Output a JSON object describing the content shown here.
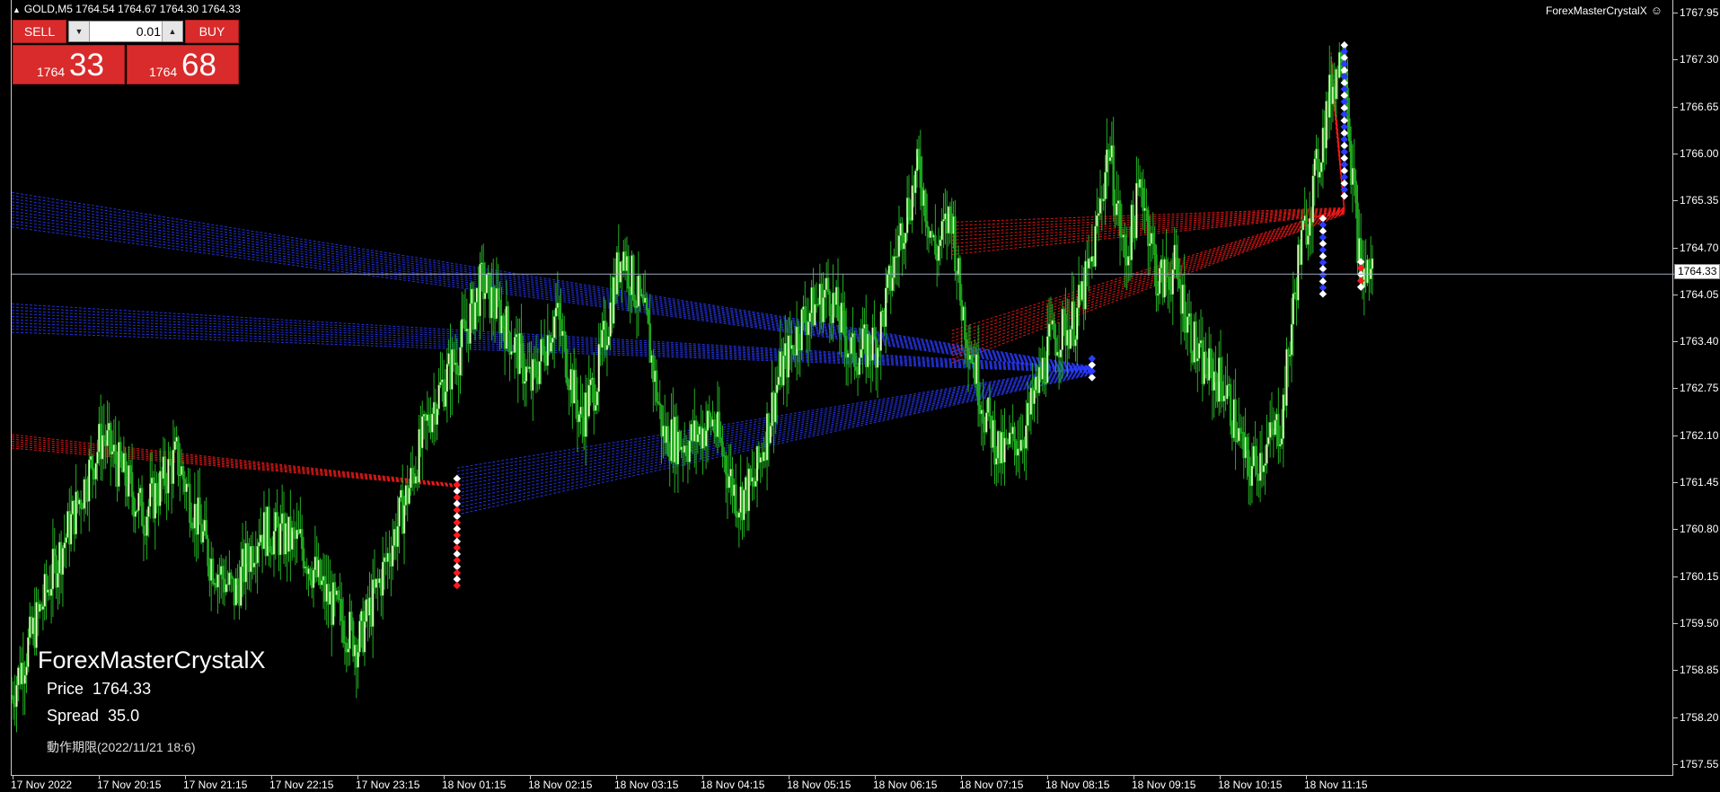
{
  "header": {
    "symbol_title": "GOLD,M5  1764.54 1764.67 1764.30 1764.33",
    "expert_name": "ForexMasterCrystalX"
  },
  "icons": {
    "collapse": "collapse-triangle-icon",
    "smile": "smiley-icon",
    "lot_down": "chevron-down-icon",
    "lot_up": "chevron-up-icon"
  },
  "trade_panel": {
    "sell_label": "SELL",
    "buy_label": "BUY",
    "lot_value": "0.01",
    "bid_small": "1764",
    "bid_big": "33",
    "ask_small": "1764",
    "ask_big": "68"
  },
  "info": {
    "title": "ForexMasterCrystalX",
    "price_label": "Price",
    "price_value": "1764.33",
    "spread_label": "Spread",
    "spread_value": "35.0",
    "expiry": "動作期限(2022/11/21 18:6)"
  },
  "price_axis": {
    "labels": [
      "1767.95",
      "1767.30",
      "1766.65",
      "1766.00",
      "1765.35",
      "1764.70",
      "1764.05",
      "1763.40",
      "1762.75",
      "1762.10",
      "1761.45",
      "1760.80",
      "1760.15",
      "1759.50",
      "1758.85",
      "1758.20",
      "1757.55"
    ],
    "current": "1764.33"
  },
  "time_axis": {
    "labels": [
      "17 Nov 2022",
      "17 Nov 20:15",
      "17 Nov 21:15",
      "17 Nov 22:15",
      "17 Nov 23:15",
      "18 Nov 01:15",
      "18 Nov 02:15",
      "18 Nov 03:15",
      "18 Nov 04:15",
      "18 Nov 05:15",
      "18 Nov 06:15",
      "18 Nov 07:15",
      "18 Nov 08:15",
      "18 Nov 09:15",
      "18 Nov 10:15",
      "18 Nov 11:15"
    ]
  },
  "colors": {
    "background": "#000000",
    "candle_up": "#f2ffcc",
    "candle_down": "#1ba81b",
    "wick": "#22b022",
    "sell_button": "#d92b2b",
    "blue_fan": "#2a3bff",
    "red_fan": "#ff1a1a",
    "grid_line": "#a0a8c0"
  },
  "chart_data": {
    "type": "candlestick",
    "ylim": [
      1757.4,
      1768.1
    ],
    "current_price": 1764.33,
    "close_path": [
      [
        0,
        1758.5
      ],
      [
        25,
        1760.2
      ],
      [
        55,
        1762.1
      ],
      [
        80,
        1761.0
      ],
      [
        100,
        1761.8
      ],
      [
        120,
        1760.4
      ],
      [
        135,
        1759.9
      ],
      [
        150,
        1760.8
      ],
      [
        175,
        1760.6
      ],
      [
        190,
        1759.9
      ],
      [
        210,
        1759.2
      ],
      [
        225,
        1760.2
      ],
      [
        240,
        1761.3
      ],
      [
        255,
        1762.5
      ],
      [
        270,
        1763.2
      ],
      [
        285,
        1764.2
      ],
      [
        300,
        1763.6
      ],
      [
        315,
        1762.8
      ],
      [
        330,
        1763.8
      ],
      [
        345,
        1762.3
      ],
      [
        355,
        1762.9
      ],
      [
        370,
        1764.7
      ],
      [
        385,
        1763.6
      ],
      [
        395,
        1762.1
      ],
      [
        410,
        1762.0
      ],
      [
        425,
        1762.3
      ],
      [
        440,
        1761.2
      ],
      [
        450,
        1761.4
      ],
      [
        465,
        1762.9
      ],
      [
        480,
        1763.7
      ],
      [
        495,
        1764.1
      ],
      [
        510,
        1763.2
      ],
      [
        525,
        1763.4
      ],
      [
        540,
        1765.0
      ],
      [
        550,
        1765.8
      ],
      [
        560,
        1764.6
      ],
      [
        570,
        1765.2
      ],
      [
        575,
        1764.0
      ],
      [
        590,
        1762.4
      ],
      [
        600,
        1761.8
      ],
      [
        615,
        1762.2
      ],
      [
        630,
        1763.4
      ],
      [
        645,
        1763.7
      ],
      [
        655,
        1764.5
      ],
      [
        665,
        1766.1
      ],
      [
        675,
        1764.5
      ],
      [
        685,
        1765.6
      ],
      [
        695,
        1764.2
      ],
      [
        705,
        1764.4
      ],
      [
        720,
        1763.1
      ],
      [
        735,
        1762.8
      ],
      [
        750,
        1761.6
      ],
      [
        760,
        1761.9
      ],
      [
        770,
        1762.3
      ],
      [
        780,
        1764.5
      ],
      [
        790,
        1765.6
      ],
      [
        800,
        1766.9
      ],
      [
        808,
        1767.5
      ],
      [
        812,
        1765.9
      ],
      [
        818,
        1764.3
      ],
      [
        825,
        1764.4
      ]
    ],
    "blue_fan_targets": [
      1763.0,
      1761.5,
      1765.1
    ],
    "red_fan_targets": [
      1765.2,
      1761.4
    ]
  }
}
